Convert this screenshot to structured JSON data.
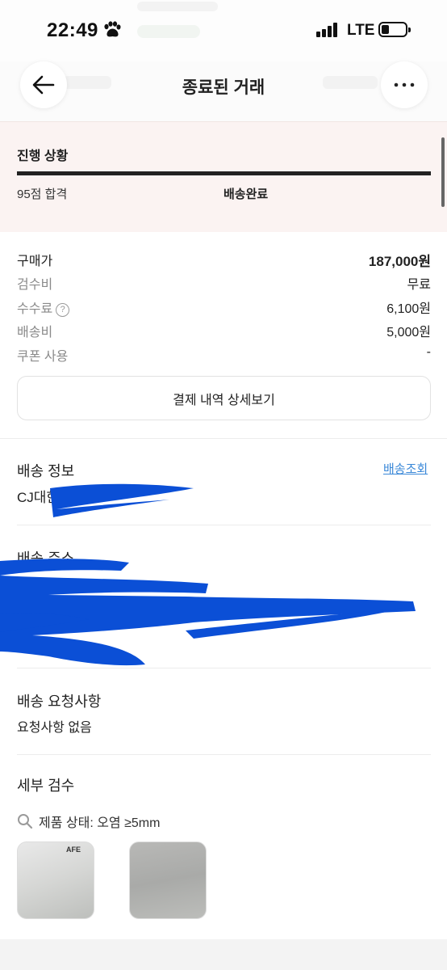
{
  "status_bar": {
    "time": "22:49",
    "network": "LTE"
  },
  "nav": {
    "title": "종료된 거래",
    "back_icon": "arrow-left-icon",
    "more_icon": "more-horizontal-icon"
  },
  "progress": {
    "title": "진행 상황",
    "step1": "95점 합격",
    "step2": "배송완료",
    "level": 1.0
  },
  "price": {
    "rows": [
      {
        "label": "구매가",
        "value": "187,000원"
      },
      {
        "label": "검수비",
        "value": "무료"
      },
      {
        "label": "수수료",
        "value": "6,100원"
      },
      {
        "label": "배송비",
        "value": "5,000원"
      },
      {
        "label": "쿠폰 사용",
        "value": "-"
      }
    ],
    "detail_button": "결제 내역 상세보기"
  },
  "shipping": {
    "title": "배송 정보",
    "track_link": "배송조회",
    "carrier": "CJ대한"
  },
  "address": {
    "title": "배송 주소"
  },
  "request": {
    "title": "배송 요청사항",
    "text": "요청사항 없음"
  },
  "inspection": {
    "title": "세부 검수",
    "condition": "제품 상태: 오염 ≥5mm",
    "search_icon": "search-icon"
  },
  "colors": {
    "progress_bg": "#fbf3f2",
    "link": "#3a88d8",
    "redaction": "#0b4fd6"
  }
}
